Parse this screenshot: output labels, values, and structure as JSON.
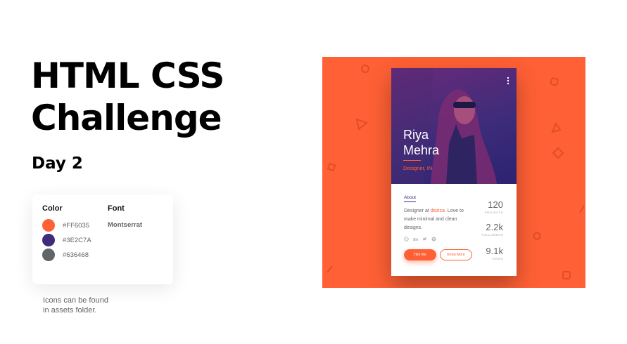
{
  "heading": {
    "title_line1": "HTML CSS",
    "title_line2": "Challenge",
    "subtitle": "Day 2"
  },
  "style_guide": {
    "color_title": "Color",
    "font_title": "Font",
    "colors": [
      {
        "hex": "#FF6035"
      },
      {
        "hex": "#3E2C7A"
      },
      {
        "hex": "#636468"
      }
    ],
    "font": "Montserrat"
  },
  "note": "Icons can be found\nin assets folder.",
  "preview": {
    "background": "#FF6035",
    "profile": {
      "first_name": "Riya",
      "last_name": "Mehra",
      "role": "Designer, IN",
      "tab_label": "About",
      "bio_prefix": "Designer at ",
      "bio_highlight": "dezica",
      "bio_suffix": ". Love to make minimal and clean designs.",
      "social_icons": [
        "dribbble-icon",
        "behance-icon",
        "twitter-icon",
        "github-icon"
      ],
      "hire_label": "Hire Me",
      "more_label": "Know More",
      "stats": [
        {
          "value": "120",
          "label": "PROJECTS"
        },
        {
          "value": "2.2k",
          "label": "FOLLOWERS"
        },
        {
          "value": "9.1k",
          "label": "VIEWS"
        }
      ]
    }
  }
}
